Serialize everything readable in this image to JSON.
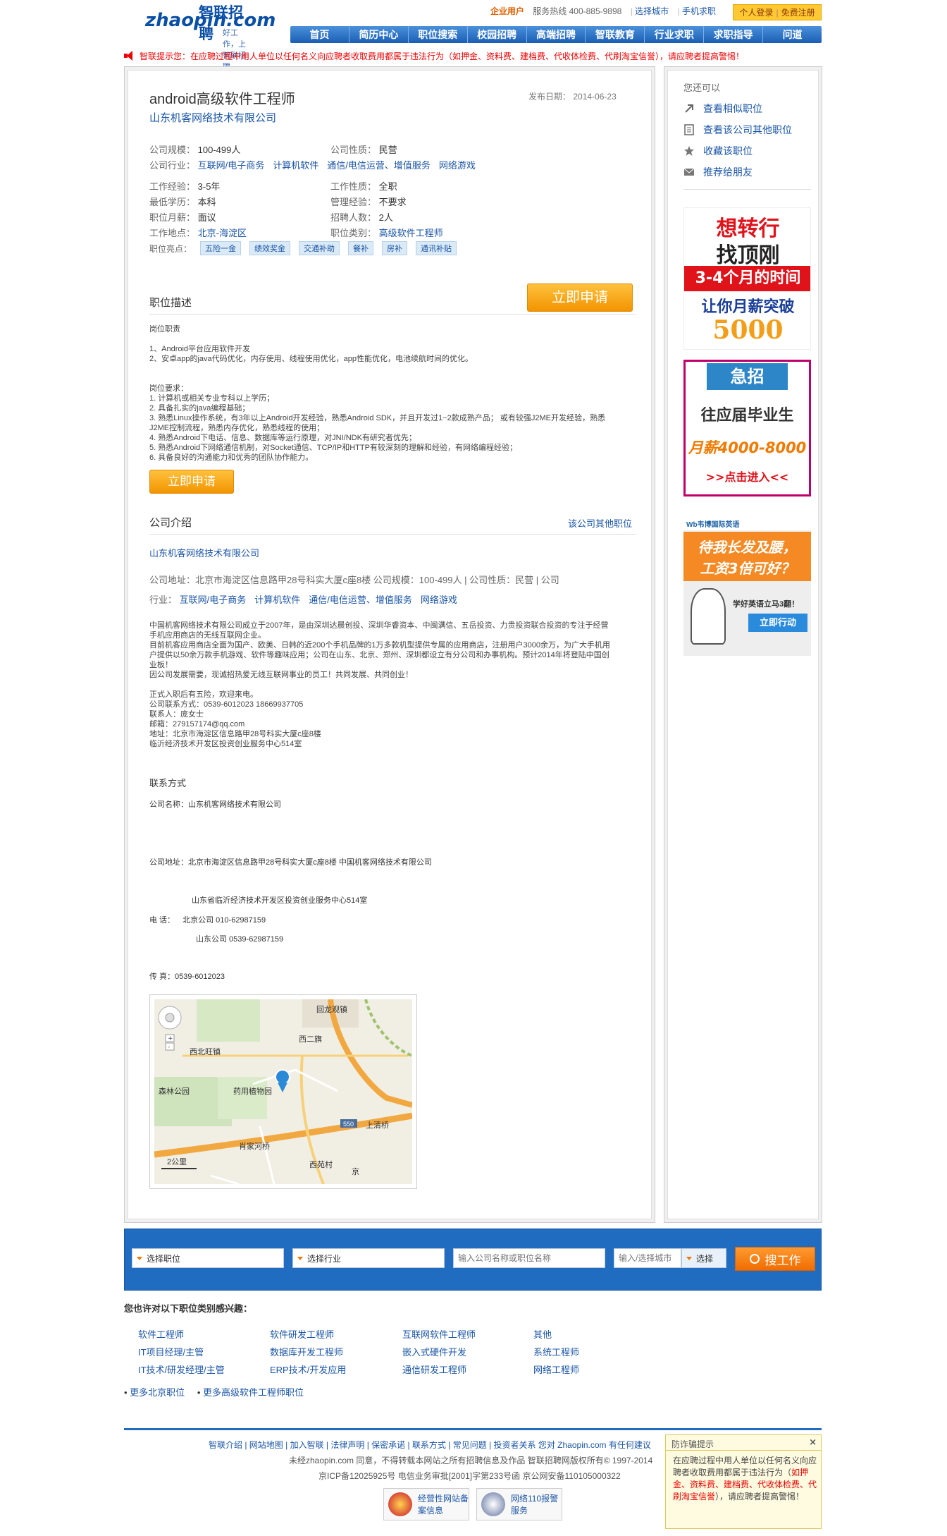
{
  "header": {
    "logo_top": "智联招聘",
    "logo_main": "zhaopin.com",
    "slogan": "好工作，上智联招聘",
    "corp_user": "企业用户",
    "hotline": "服务热线 400-885-9898",
    "choose_city": "选择城市",
    "mobile_job": "手机求职",
    "personal_login": "个人登录",
    "free_register": "免费注册",
    "nav": [
      "首页",
      "简历中心",
      "职位搜索",
      "校园招聘",
      "高端招聘",
      "智联教育",
      "行业求职",
      "求职指导",
      "问道"
    ]
  },
  "notice": "智联提示您：在应聘过程中用人单位以任何名义向应聘者收取费用都属于违法行为（如押金、资料费、建档费、代收体检费、代刷淘宝信誉），请应聘者提高警惕！",
  "job": {
    "title": "android高级软件工程师",
    "publish_label": "发布日期：",
    "publish_date": "2014-06-23",
    "company": "山东机客网络技术有限公司",
    "scale_label": "公司规模：",
    "scale": "100-499人",
    "nature_label": "公司性质：",
    "nature": "民营",
    "industry_label": "公司行业：",
    "industries": [
      "互联网/电子商务",
      "计算机软件",
      "通信/电信运营、增值服务",
      "网络游戏"
    ],
    "exp_label": "工作经验：",
    "exp": "3-5年",
    "type_label": "工作性质：",
    "type": "全职",
    "edu_label": "最低学历：",
    "edu": "本科",
    "mgmt_label": "管理经验：",
    "mgmt": "不要求",
    "salary_label": "职位月薪：",
    "salary": "面议",
    "count_label": "招聘人数：",
    "count": "2人",
    "location_label": "工作地点：",
    "location": "北京-海淀区",
    "category_label": "职位类别：",
    "category": "高级软件工程师",
    "highlight_label": "职位亮点：",
    "highlights": [
      "五险一金",
      "绩效奖金",
      "交通补助",
      "餐补",
      "房补",
      "通讯补贴"
    ],
    "apply": "立即申请",
    "desc_title": "职位描述",
    "desc_text": "岗位职责\n\n1、Android平台应用软件开发\n2、安卓app的java代码优化，内存使用、线程使用优化，app性能优化，电池续航时间的优化。\n\n\n岗位要求：\n1. 计算机或相关专业专科以上学历；\n2. 具备扎实的java编程基础；\n3. 熟悉Linux操作系统，有3年以上Android开发经验，熟悉Android SDK，并且开发过1~2款成熟产品； 或有较强J2ME开发经验，熟悉J2ME控制流程，熟悉内存优化，熟悉线程的使用；\n4. 熟悉Android下电话、信息、数据库等运行原理，对JNI/NDK有研究者优先；\n5. 熟悉Android下网络通信机制，对Socket通信、TCP/IP和HTTP有较深刻的理解和经验，有网络编程经验；\n6. 具备良好的沟通能力和优秀的团队协作能力。"
  },
  "company_intro": {
    "title": "公司介绍",
    "other_jobs": "该公司其他职位",
    "name": "山东机客网络技术有限公司",
    "line1": "公司地址：北京市海淀区信息路甲28号科实大厦c座8楼  公司规模：100-499人 | 公司性质：民营 | 公司",
    "industry_prefix": "行业：",
    "intro": "中国机客网络技术有限公司成立于2007年，是由深圳达晨创投、深圳华睿资本、中闽满信、五岳投资、力贵投资联合投资的专注于经营手机应用商店的无线互联网企业。\n目前机客应用商店全面为国产、欧美、日韩的近200个手机品牌的1万多款机型提供专属的应用商店，注册用户3000余万，为广大手机用户提供以50余万款手机游戏、软件等趣味应用；公司在山东、北京、郑州、深圳都设立有分公司和办事机构。预计2014年将登陆中国创业板！\n因公司发展需要，现诚招热爱无线互联网事业的员工！共同发展、共同创业！\n\n正式入职后有五险，欢迎来电。\n公司联系方式：0539-6012023  18669937705\n联系人：庞女士\n邮箱：279157174@qq.com\n地址：北京市海淀区信息路甲28号科实大厦c座8楼\n临沂经济技术开发区投资创业服务中心514室",
    "contact_title": "联系方式",
    "contact_name": "公司名称：山东机客网络技术有限公司",
    "contact_addr": "公司地址：北京市海淀区信息路甲28号科实大厦c座8楼   中国机客网络技术有限公司",
    "contact_addr2": "山东省临沂经济技术开发区投资创业服务中心514室",
    "phone_label": "电    话：",
    "phone1": "北京公司   010-62987159",
    "phone2": "山东公司   0539-62987159",
    "fax": "传    真：0539-6012023",
    "map": {
      "labels": [
        "回龙观镇",
        "西二旗",
        "西北旺镇",
        "森林公园",
        "药用植物园",
        "上清桥",
        "肖家河桥",
        "西苑村",
        "京",
        "2公里",
        "550"
      ]
    }
  },
  "sidebar": {
    "title": "您还可以",
    "links": [
      "查看相似职位",
      "查看该公司其他职位",
      "收藏该职位",
      "推荐给朋友"
    ],
    "ad1": [
      "想转行",
      "找顶刚",
      "3-4个月的时间",
      "让你月薪突破",
      "5000"
    ],
    "ad2": [
      "急招",
      "往应届毕业生",
      "月薪4000-8000",
      ">>点击进入<<"
    ],
    "ad3": [
      "Wb韦博国际英语",
      "待我长发及腰，",
      "工资3倍可好？",
      "学好英语立马3翻！",
      "立即行动"
    ]
  },
  "search": {
    "job": "选择职位",
    "industry": "选择行业",
    "keyword_placeholder": "输入公司名称或职位名称",
    "city_placeholder": "输入/选择城市",
    "select": "选择",
    "button": "搜工作"
  },
  "maybe": {
    "title": "您也许对以下职位类别感兴趣：",
    "categories": [
      "软件工程师",
      "软件研发工程师",
      "互联网软件工程师",
      "其他",
      "IT项目经理/主管",
      "数据库开发工程师",
      "嵌入式硬件开发",
      "系统工程师",
      "IT技术/研发经理/主管",
      "ERP技术/开发应用",
      "通信研发工程师",
      "网络工程师"
    ],
    "more1": "更多北京职位",
    "more2": "更多高级软件工程师职位"
  },
  "footer": {
    "links": "智联介绍 | 网站地图 | 加入智联 | 法律声明 | 保密承诺 | 联系方式 | 常见问题 | 投资者关系  您对 Zhaopin.com 有任何建议",
    "line2": "未经zhaopin.com 同意，不得转载本网站之所有招聘信息及作品 智联招聘网版权所有© 1997-2014",
    "line3": "京ICP备12025925号 电信业务审批[2001]字第233号函 京公网安备110105000322",
    "badge1": [
      "经营性网站备",
      "案信息"
    ],
    "badge2": [
      "网络110报警",
      "服务"
    ]
  },
  "popup": {
    "title": "防诈骗提示",
    "close": "×",
    "text_a": "在应聘过程中用人单位以任何名义向应聘者收取费用都属于违法行为（",
    "text_b": "如押金、资料费、建档费、代收体检费、代刷淘宝信誉",
    "text_c": "），请应聘者提高警惕！"
  }
}
